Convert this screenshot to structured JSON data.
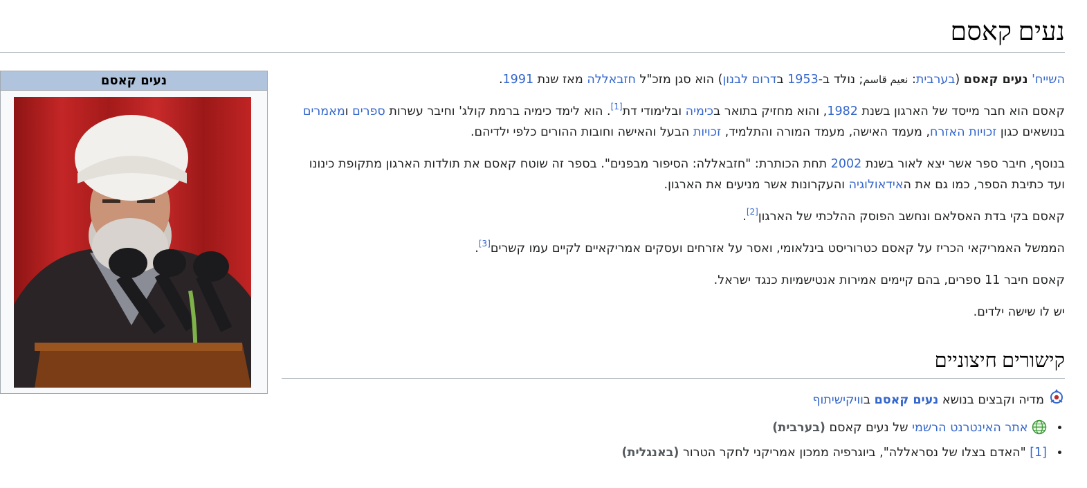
{
  "page": {
    "title": "נעים קאסם"
  },
  "infobox": {
    "header": "נעים קאסם"
  },
  "intro": {
    "p1": {
      "t1": "השייח'",
      "name": "נעים קאסם",
      "t2": " (",
      "lang_link": "בערבית",
      "t3": ": ",
      "arabic": "نعيم قاسم",
      "t4": "; נולד ב-",
      "year": "1953",
      "t5": " ב",
      "place": "דרום לבנון",
      "t6": ") הוא סגן מזכ\"ל ",
      "org": "חזבאללה",
      "t7": " מאז שנת ",
      "since": "1991",
      "t8": "."
    },
    "p2": {
      "t1": "קאסם הוא חבר מייסד של הארגון בשנת ",
      "year": "1982",
      "t2": ", והוא מחזיק בתואר ב",
      "chem": "כימיה",
      "t3": " ובלימודי דת",
      "ref": "[1]",
      "t4": ". הוא לימד כימיה ברמת קולג' וחיבר עשרות ",
      "books": "ספרים",
      "t5": " ו",
      "articles": "מאמרים",
      "t6": " בנושאים כגון ",
      "civil": "זכויות האזרח",
      "t7": ", מעמד האישה, מעמד המורה והתלמיד, ",
      "rights": "זכויות",
      "t8": " הבעל והאישה וחובות ההורים כלפי ילדיהם."
    },
    "p3": {
      "t1": "בנוסף, חיבר ספר אשר יצא לאור בשנת ",
      "year": "2002",
      "t2": " תחת הכותרת: \"חזבאללה: הסיפור מבפנים\". בספר זה שוטח קאסם את תולדות הארגון מתקופת כינונו ועד כתיבת הספר, כמו גם את ה",
      "ideology": "אידאולוגיה",
      "t3": " והעקרונות אשר מניעים את הארגון."
    },
    "p4": {
      "t1": "קאסם בקי בדת האסלאם ונחשב הפוסק ההלכתי של הארגון",
      "ref": "[2]",
      "t2": "."
    },
    "p5": {
      "t1": "הממשל האמריקאי הכריז על קאסם כטרוריסט בינלאומי, ואסר על אזרחים ועסקים אמריקאיים לקיים עמו קשרים",
      "ref": "[3]",
      "t2": "."
    },
    "p6": "קאסם חיבר 11 ספרים, בהם קיימים אמירות אנטישמיות כנגד ישראל.",
    "p7": "יש לו שישה ילדים."
  },
  "external": {
    "heading": "קישורים חיצוניים",
    "commons": {
      "t1": "מדיה וקבצים בנושא ",
      "subject": "נעים קאסם",
      "t2": " ב",
      "link": "וויקישיתוף"
    },
    "items": [
      {
        "link": "אתר האינטרנט הרשמי",
        "text": " של נעים קאסם ",
        "lang": "(בערבית)"
      },
      {
        "link": "[1]",
        "text": " \"האדם בצלו של נסראללה\", ביוגרפיה ממכון אמריקני לחקר הטרור ",
        "lang": "(באנגלית)"
      }
    ]
  }
}
